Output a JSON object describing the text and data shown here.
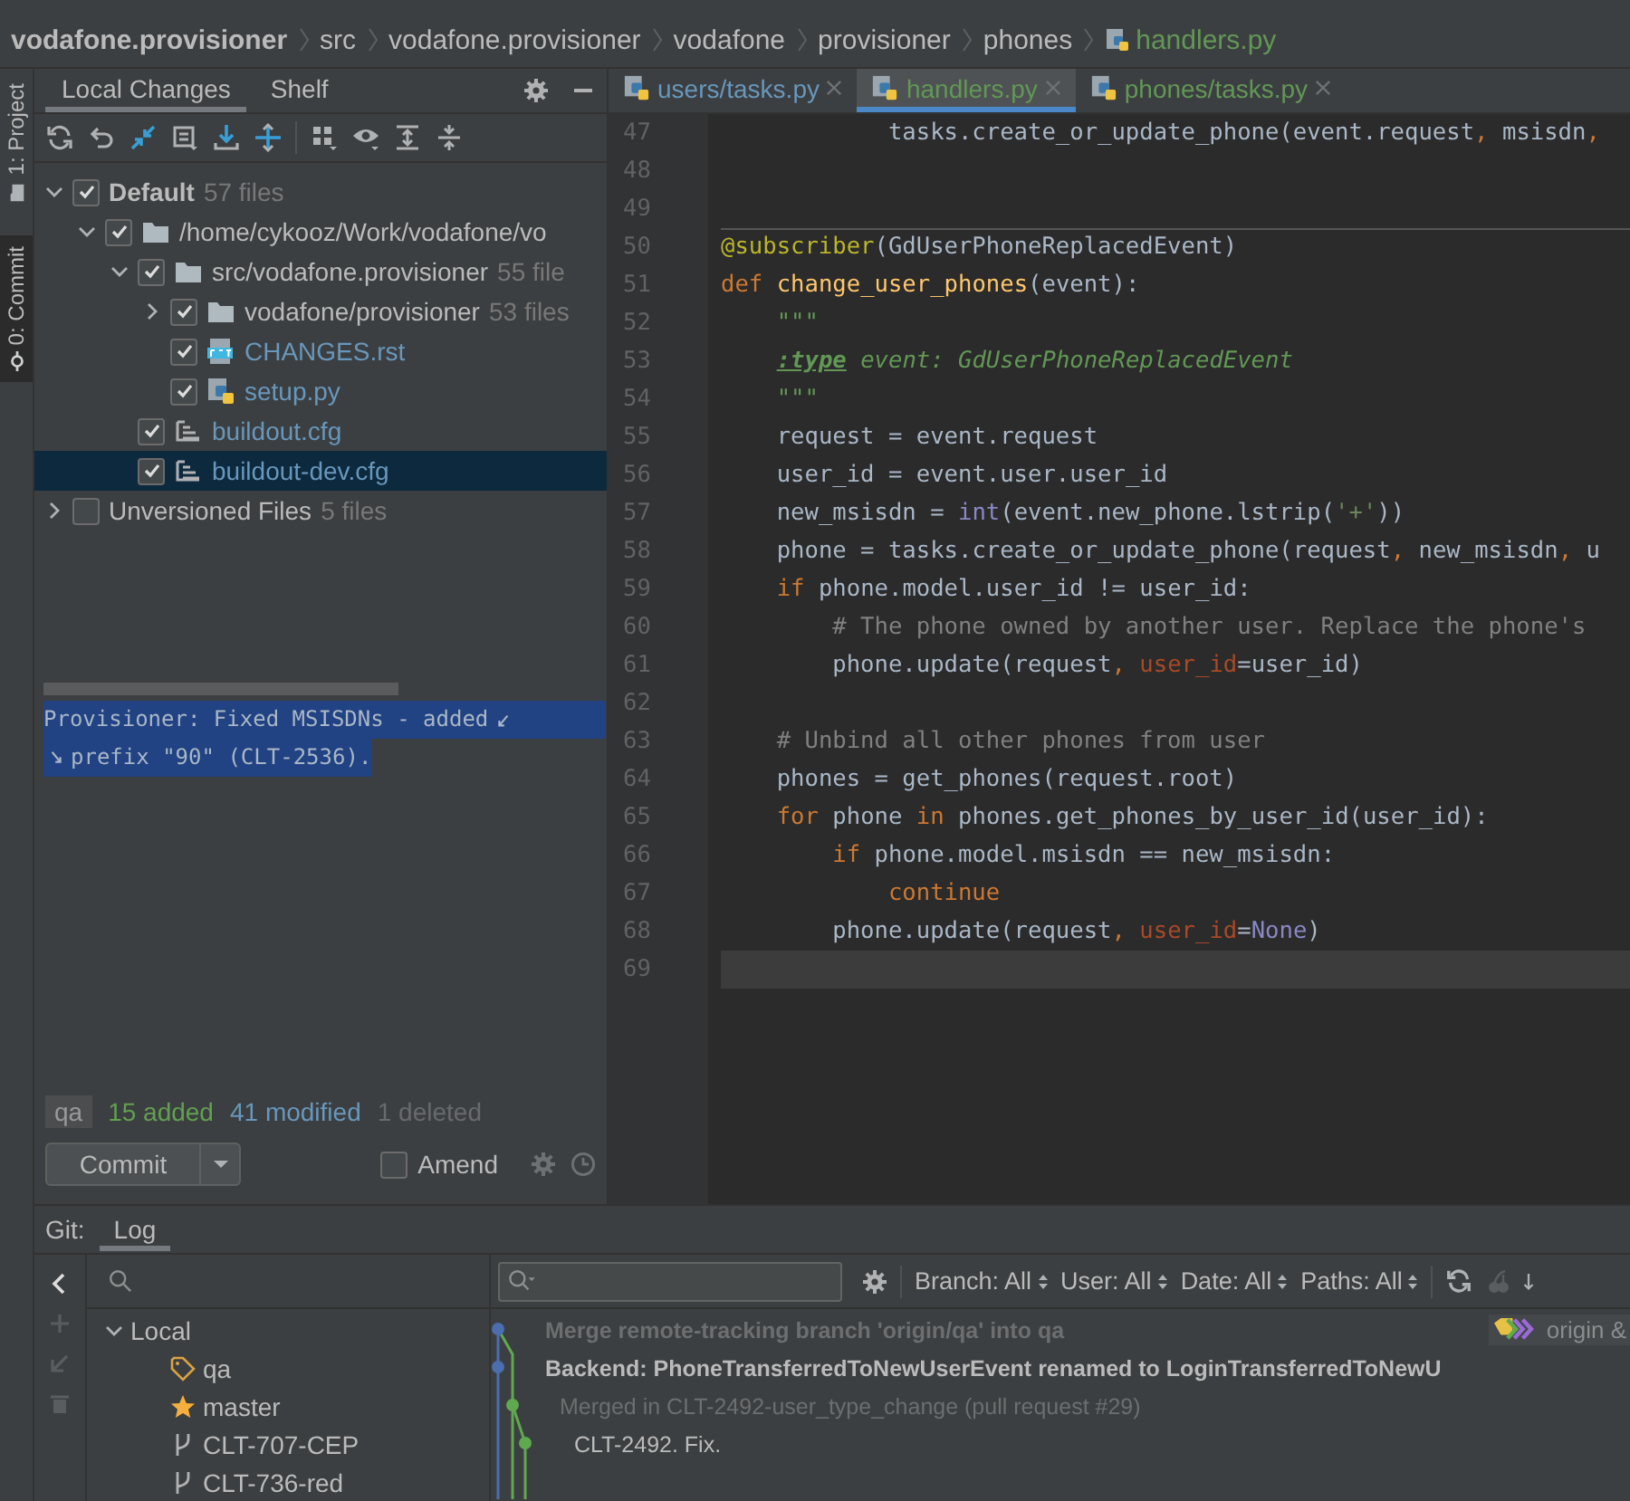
{
  "breadcrumb": [
    {
      "label": "vodafone.provisioner",
      "kind": "project",
      "color": "#bbbbbb"
    },
    {
      "label": "src",
      "kind": "folder",
      "color": "#bbbbbb"
    },
    {
      "label": "vodafone.provisioner",
      "kind": "folder",
      "color": "#bbbbbb"
    },
    {
      "label": "vodafone",
      "kind": "folder",
      "color": "#bbbbbb"
    },
    {
      "label": "provisioner",
      "kind": "folder",
      "color": "#bbbbbb"
    },
    {
      "label": "phones",
      "kind": "folder",
      "color": "#bbbbbb"
    },
    {
      "label": "handlers.py",
      "kind": "file",
      "color": "#629755"
    }
  ],
  "tool_windows": [
    {
      "label": "1: Project",
      "kind": "project",
      "selected": false
    },
    {
      "label": "0: Commit",
      "kind": "commit",
      "selected": true
    }
  ],
  "changes": {
    "tabs": [
      {
        "label": "Local Changes",
        "selected": true
      },
      {
        "label": "Shelf",
        "selected": false
      }
    ],
    "tree": [
      {
        "name": "Default",
        "count": "57 files",
        "active": true,
        "checked": true,
        "expanded": true,
        "selected": false,
        "color": "#bbbbbb",
        "children": [
          {
            "name": "/home/cykooz/Work/vodafone/vo",
            "kind": "folder",
            "checked": true,
            "expanded": true,
            "selected": false,
            "color": "#bbbbbb",
            "children": [
              {
                "name": "src/vodafone.provisioner",
                "count": "55 file",
                "kind": "folder",
                "checked": true,
                "expanded": true,
                "selected": false,
                "color": "#bbbbbb",
                "children": [
                  {
                    "name": "vodafone/provisioner",
                    "count": "53 files",
                    "kind": "folder",
                    "checked": true,
                    "expanded": false,
                    "selected": false,
                    "color": "#bbbbbb"
                  },
                  {
                    "name": "CHANGES.rst",
                    "kind": "rst-file",
                    "checked": true,
                    "selected": false,
                    "color": "#6897bb"
                  },
                  {
                    "name": "setup.py",
                    "kind": "python-file",
                    "checked": true,
                    "selected": false,
                    "color": "#6897bb"
                  }
                ]
              },
              {
                "name": "buildout.cfg",
                "kind": "config-file",
                "checked": true,
                "selected": false,
                "color": "#6897bb"
              },
              {
                "name": "buildout-dev.cfg",
                "kind": "config-file",
                "checked": true,
                "selected": true,
                "color": "#6897bb"
              }
            ]
          }
        ]
      },
      {
        "name": "Unversioned Files",
        "count": "5 files",
        "active": false,
        "checked": false,
        "expanded": false,
        "selected": false,
        "color": "#bbbbbb"
      }
    ],
    "message_lines": [
      "Provisioner: Fixed MSISDNs - added",
      "prefix \"90\" (CLT-2536)."
    ],
    "branch": "qa",
    "added": "15 added",
    "modified": "41 modified",
    "deleted": "1 deleted",
    "commit_button": "Commit",
    "amend": {
      "label": "Amend",
      "checked": false
    }
  },
  "editor": {
    "tabs": [
      {
        "label": "users/tasks.py",
        "color": "#6897bb",
        "selected": false
      },
      {
        "label": "handlers.py",
        "color": "#629755",
        "selected": true
      },
      {
        "label": "phones/tasks.py",
        "color": "#629755",
        "selected": false
      }
    ],
    "lines": [
      {
        "number": "47",
        "separator": false,
        "current": false,
        "tokens": [
          {
            "kind": "plain",
            "text": "            tasks.create_or_update_phone(event.request"
          },
          {
            "kind": "punct",
            "text": ","
          },
          {
            "kind": "plain",
            "text": " msisdn"
          },
          {
            "kind": "punct",
            "text": ","
          }
        ]
      },
      {
        "number": "48",
        "separator": false,
        "current": false
      },
      {
        "number": "49",
        "separator": false,
        "current": false
      },
      {
        "number": "50",
        "separator": true,
        "current": false,
        "tokens": [
          {
            "kind": "decorator",
            "text": "@subscriber"
          },
          {
            "kind": "plain",
            "text": "(GdUserPhoneReplacedEvent)"
          }
        ]
      },
      {
        "number": "51",
        "separator": false,
        "current": false,
        "tokens": [
          {
            "kind": "keyword",
            "text": "def"
          },
          {
            "kind": "function",
            "text": " change_user_phones"
          },
          {
            "kind": "plain",
            "text": "(event):"
          }
        ]
      },
      {
        "number": "52",
        "separator": false,
        "current": false,
        "tokens": [
          {
            "kind": "docstring",
            "text": "    \"\"\""
          }
        ]
      },
      {
        "number": "53",
        "separator": false,
        "current": false,
        "tokens": [
          {
            "kind": "doctag",
            "text": "    :type"
          },
          {
            "kind": "docstring",
            "text": " event: GdUserPhoneReplacedEvent"
          }
        ]
      },
      {
        "number": "54",
        "separator": false,
        "current": false,
        "tokens": [
          {
            "kind": "docstring",
            "text": "    \"\"\""
          }
        ]
      },
      {
        "number": "55",
        "separator": false,
        "current": false,
        "tokens": [
          {
            "kind": "plain",
            "text": "    request = event.request"
          }
        ]
      },
      {
        "number": "56",
        "separator": false,
        "current": false,
        "tokens": [
          {
            "kind": "plain",
            "text": "    user_id = event.user.user_id"
          }
        ]
      },
      {
        "number": "57",
        "separator": false,
        "current": false,
        "tokens": [
          {
            "kind": "plain",
            "text": "    new_msisdn = "
          },
          {
            "kind": "builtin",
            "text": "int"
          },
          {
            "kind": "plain",
            "text": "(event.new_phone.lstrip("
          },
          {
            "kind": "string",
            "text": "'+'"
          },
          {
            "kind": "plain",
            "text": "))"
          }
        ]
      },
      {
        "number": "58",
        "separator": false,
        "current": false,
        "tokens": [
          {
            "kind": "plain",
            "text": "    phone = tasks.create_or_update_phone(request"
          },
          {
            "kind": "punct",
            "text": ","
          },
          {
            "kind": "plain",
            "text": " new_msisdn"
          },
          {
            "kind": "punct",
            "text": ","
          },
          {
            "kind": "plain",
            "text": " u"
          }
        ]
      },
      {
        "number": "59",
        "separator": false,
        "current": false,
        "tokens": [
          {
            "kind": "keyword",
            "text": "    if"
          },
          {
            "kind": "plain",
            "text": " phone.model.user_id != user_id:"
          }
        ]
      },
      {
        "number": "60",
        "separator": false,
        "current": false,
        "tokens": [
          {
            "kind": "comment",
            "text": "        # The phone owned by another user. Replace the phone's"
          }
        ]
      },
      {
        "number": "61",
        "separator": false,
        "current": false,
        "tokens": [
          {
            "kind": "plain",
            "text": "        phone.update(request"
          },
          {
            "kind": "punct",
            "text": ","
          },
          {
            "kind": "param",
            "text": " user_id"
          },
          {
            "kind": "plain",
            "text": "=user_id)"
          }
        ]
      },
      {
        "number": "62",
        "separator": false,
        "current": false
      },
      {
        "number": "63",
        "separator": false,
        "current": false,
        "tokens": [
          {
            "kind": "comment",
            "text": "    # Unbind all other phones from user"
          }
        ]
      },
      {
        "number": "64",
        "separator": false,
        "current": false,
        "tokens": [
          {
            "kind": "plain",
            "text": "    phones = get_phones(request.root)"
          }
        ]
      },
      {
        "number": "65",
        "separator": false,
        "current": false,
        "tokens": [
          {
            "kind": "keyword",
            "text": "    for"
          },
          {
            "kind": "plain",
            "text": " phone "
          },
          {
            "kind": "keyword",
            "text": "in"
          },
          {
            "kind": "plain",
            "text": " phones.get_phones_by_user_id(user_id):"
          }
        ]
      },
      {
        "number": "66",
        "separator": false,
        "current": false,
        "tokens": [
          {
            "kind": "keyword",
            "text": "        if"
          },
          {
            "kind": "plain",
            "text": " phone.model.msisdn == new_msisdn:"
          }
        ]
      },
      {
        "number": "67",
        "separator": false,
        "current": false,
        "tokens": [
          {
            "kind": "keyword",
            "text": "            continue"
          }
        ]
      },
      {
        "number": "68",
        "separator": false,
        "current": false,
        "tokens": [
          {
            "kind": "plain",
            "text": "        phone.update(request"
          },
          {
            "kind": "punct",
            "text": ","
          },
          {
            "kind": "param",
            "text": " user_id"
          },
          {
            "kind": "plain",
            "text": "="
          },
          {
            "kind": "builtin",
            "text": "None"
          },
          {
            "kind": "plain",
            "text": ")"
          }
        ]
      },
      {
        "number": "69",
        "separator": false,
        "current": true
      }
    ]
  },
  "git": {
    "label": "Git:",
    "tabs": [
      {
        "label": "Log",
        "selected": true
      }
    ],
    "branches": [
      {
        "name": "Local",
        "expanded": true,
        "children": [
          {
            "name": "qa",
            "kind": "tag"
          },
          {
            "name": "master",
            "kind": "star"
          },
          {
            "name": "CLT-707-CEP",
            "kind": "branch"
          },
          {
            "name": "CLT-736-red",
            "kind": "branch"
          }
        ]
      }
    ],
    "filters": [
      "Branch: All",
      "User: All",
      "Date: All",
      "Paths: All"
    ],
    "commits": [
      {
        "subject": "Merge remote-tracking branch 'origin/qa' into qa",
        "bold": true,
        "dimmed": true,
        "refs": [
          "origin &"
        ]
      },
      {
        "subject": "Backend: PhoneTransferredToNewUserEvent renamed to LoginTransferredToNewU",
        "bold": true,
        "dimmed": false
      },
      {
        "subject": "Merged in CLT-2492-user_type_change (pull request #29)",
        "bold": false,
        "dimmed": true
      },
      {
        "subject": "CLT-2492. Fix.",
        "bold": false,
        "dimmed": false
      }
    ]
  }
}
